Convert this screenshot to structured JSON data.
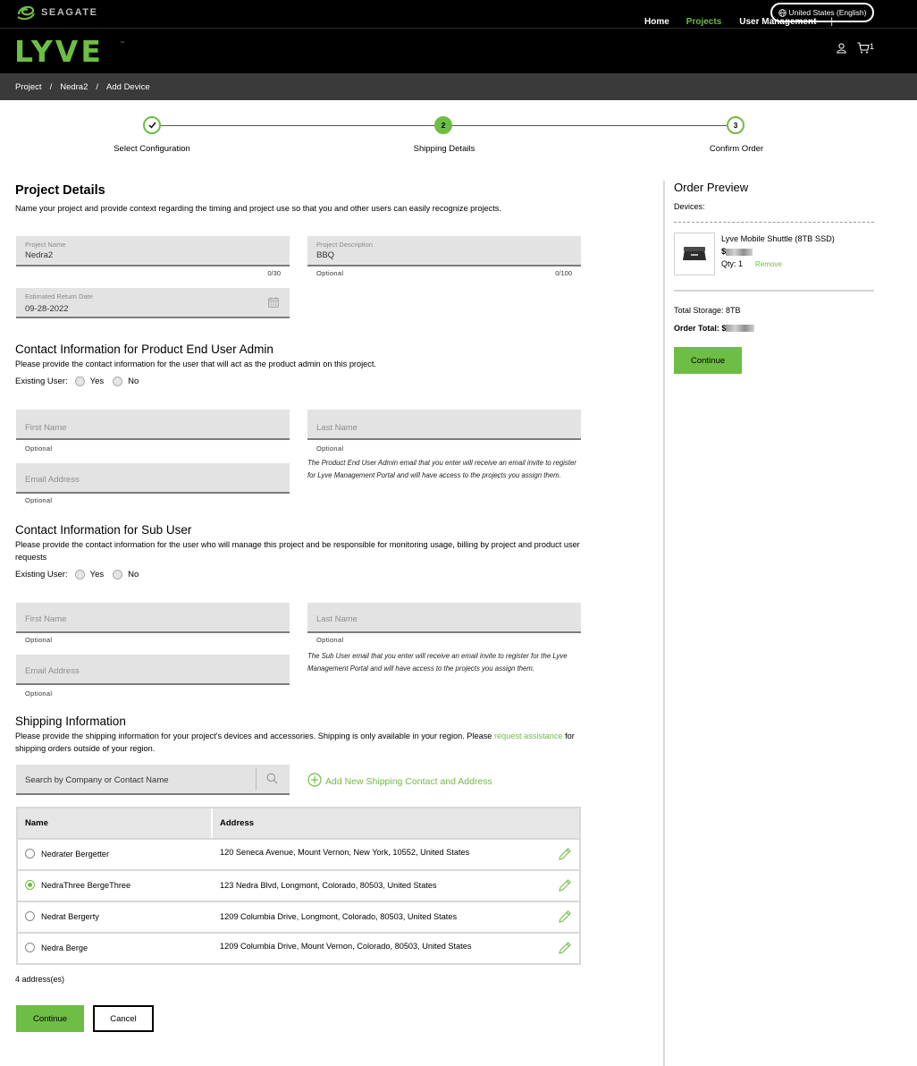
{
  "topbar": {
    "brand": "SEAGATE",
    "language": "United States (English)"
  },
  "header": {
    "logo_text": "LYVE",
    "nav": {
      "home": "Home",
      "projects": "Projects",
      "user_management": "User Management",
      "separator": "|"
    },
    "cart_count": "1"
  },
  "breadcrumb": {
    "items": [
      "Project",
      "Nedra2",
      "Add Device"
    ],
    "separator": "/"
  },
  "stepper": {
    "steps": [
      {
        "number": "1",
        "label": "Select Configuration",
        "state": "done"
      },
      {
        "number": "2",
        "label": "Shipping Details",
        "state": "current"
      },
      {
        "number": "3",
        "label": "Confirm Order",
        "state": "todo"
      }
    ]
  },
  "project_details": {
    "title": "Project Details",
    "description": "Name your project and provide context regarding the timing and project use so that you and other users can easily recognize projects.",
    "project_name": {
      "label": "Project Name",
      "value": "Nedra2",
      "counter": "0/30"
    },
    "project_description": {
      "label": "Project Description",
      "value": "BBQ",
      "helper": "Optional",
      "counter": "0/100"
    },
    "return_date": {
      "label": "Estimated Return Date",
      "value": "09-28-2022"
    }
  },
  "admin_contact": {
    "title": "Contact Information for Product End User Admin",
    "description": "Please provide the contact information for the user that will act as the product admin on this project.",
    "existing_label": "Existing User:",
    "yes": "Yes",
    "no": "No",
    "first_name": {
      "placeholder": "First Name",
      "helper": "Optional"
    },
    "last_name": {
      "placeholder": "Last Name",
      "helper": "Optional"
    },
    "email": {
      "placeholder": "Email Address",
      "helper": "Optional"
    },
    "note": "The Product End User Admin email that you enter will receive an email invite to register for Lyve Management Portal and will have access to the projects you assign them."
  },
  "sub_user": {
    "title": "Contact Information for Sub User",
    "description": "Please provide the contact information for the user who will manage this project and be responsible for monitoring usage, billing by project and product user requests",
    "existing_label": "Existing User:",
    "yes": "Yes",
    "no": "No",
    "first_name": {
      "placeholder": "First Name",
      "helper": "Optional"
    },
    "last_name": {
      "placeholder": "Last Name",
      "helper": "Optional"
    },
    "email": {
      "placeholder": "Email Address",
      "helper": "Optional"
    },
    "note": "The Sub User email that you enter will receive an email invite to register for the Lyve Management Portal and will have access to the projects you assign them."
  },
  "shipping": {
    "title": "Shipping Information",
    "description_before": "Please provide the shipping information for your project's devices and accessories. Shipping is only available in your region. Please ",
    "assist_link": "request assistance",
    "description_after": " for shipping orders outside of your region.",
    "search_placeholder": "Search by Company or Contact Name",
    "add_new": "Add New Shipping Contact and Address",
    "columns": {
      "name": "Name",
      "address": "Address"
    },
    "rows": [
      {
        "name": "Nedrater Bergetter",
        "address": "120 Seneca Avenue, Mount Vernon, New York, 10552, United States"
      },
      {
        "name": "NedraThree BergeThree",
        "address": "123 Nedra Blvd, Longmont, Colorado, 80503, United States"
      },
      {
        "name": "Nedrat Bergerty",
        "address": "1209 Columbia Drive, Longmont, Colorado, 80503, United States"
      },
      {
        "name": "Nedra Berge",
        "address": "1209 Columbia Drive, Mount Vernon, Colorado, 80503, United States"
      }
    ],
    "count": "4 address(es)",
    "continue": "Continue",
    "cancel": "Cancel"
  },
  "order_preview": {
    "title": "Order Preview",
    "devices_label": "Devices:",
    "device_name": "Lyve Mobile Shuttle (8TB SSD)",
    "price_prefix": "$",
    "qty": "Qty: 1",
    "remove": "Remove",
    "total_storage": "Total Storage: 8TB",
    "order_total": "Order Total: $",
    "continue": "Continue"
  },
  "colors": {
    "accent": "#6ebd44",
    "header_bg": "#000000",
    "breadcrumb_bg": "#3a3a3a",
    "field_bg": "#e3e3e3"
  }
}
